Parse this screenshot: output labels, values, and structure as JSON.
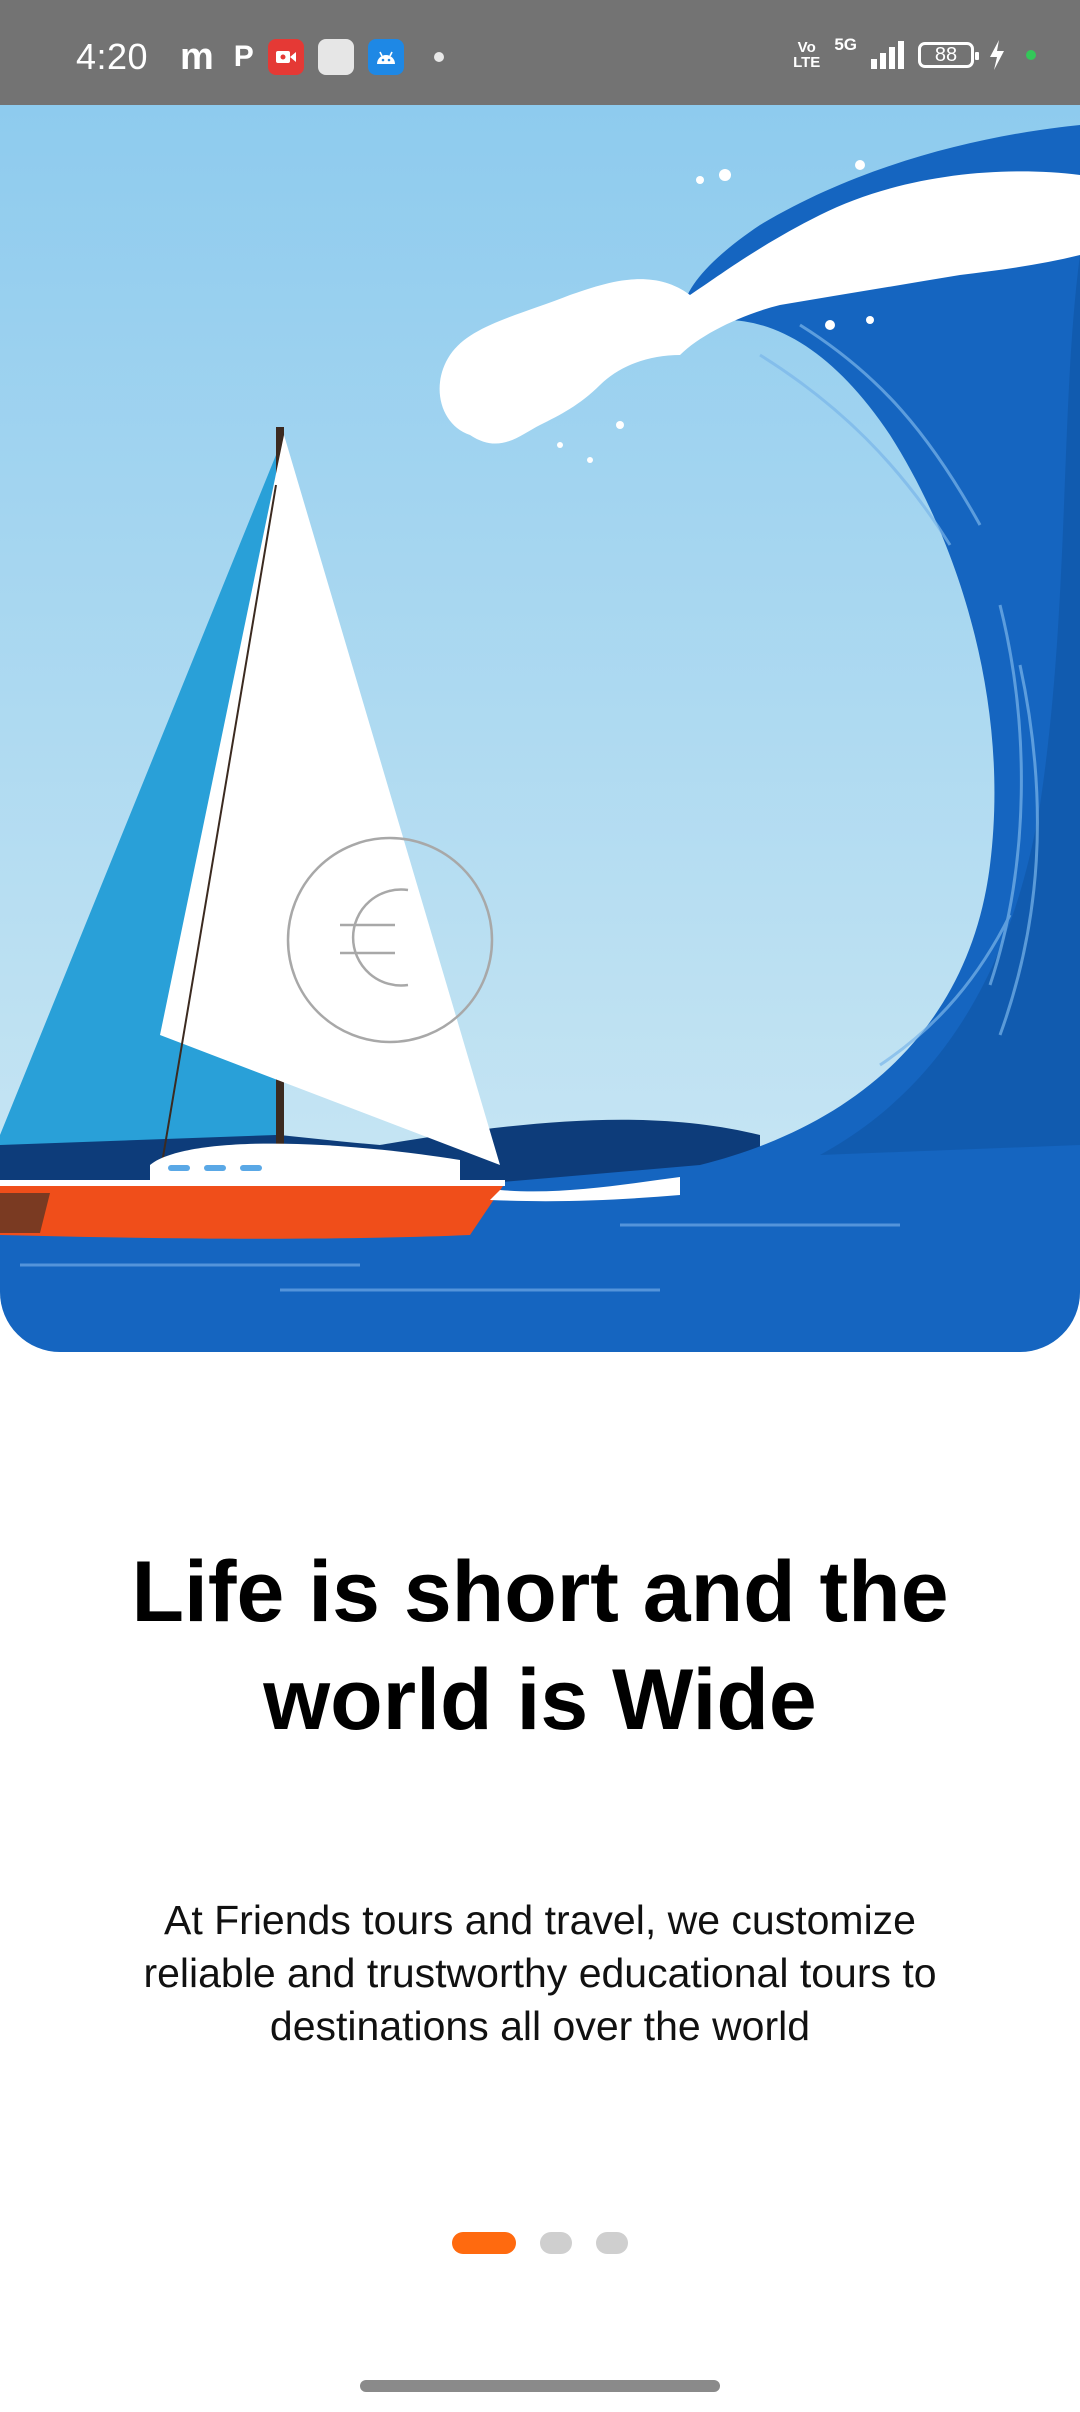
{
  "status_bar": {
    "time": "4:20",
    "left_icons": [
      "m-app-icon",
      "p-app-icon",
      "screen-record-icon",
      "square-icon",
      "android-icon",
      "dot-icon"
    ],
    "volte_line1": "Vo",
    "volte_line2": "LTE",
    "network": "5G",
    "battery": "88",
    "colors": {
      "bar": "#737373",
      "record": "#e53935",
      "android": "#1e88e5",
      "green": "#34c759"
    }
  },
  "onboarding": {
    "title_line1": "Life is short and the",
    "title_line2": "world is Wide",
    "description": "At Friends tours and travel, we customize reliable and trustworthy educational tours to destinations all over the world",
    "page_indicator": {
      "total": 3,
      "active_index": 0,
      "active_color": "#ff6a0f",
      "inactive_color": "#cfcfcf"
    }
  },
  "illustration": {
    "subject": "sailboat-with-euro-sail-under-giant-wave",
    "sail_symbol": "€",
    "colors": {
      "sky": "#9dd3ef",
      "wave": "#1565c0",
      "sail_blue": "#29a0d8",
      "hull": "#f04e1a"
    }
  }
}
